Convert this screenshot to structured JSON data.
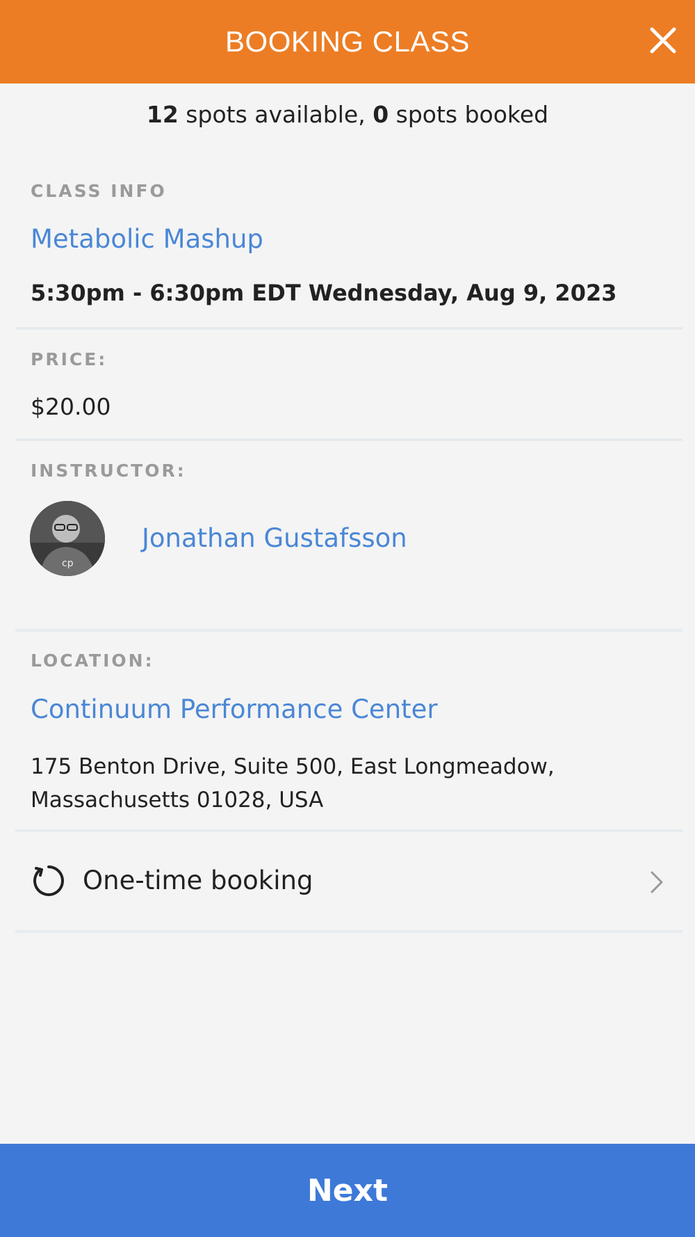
{
  "header": {
    "title": "BOOKING CLASS",
    "close_icon": "close-icon"
  },
  "availability": {
    "spots_available": "12",
    "available_text": " spots available, ",
    "spots_booked": "0",
    "booked_text": " spots booked"
  },
  "class_info": {
    "label": "CLASS INFO",
    "name": "Metabolic Mashup",
    "time": "5:30pm - 6:30pm EDT Wednesday, Aug 9, 2023"
  },
  "price": {
    "label": "PRICE:",
    "value": "$20.00"
  },
  "instructor": {
    "label": "INSTRUCTOR:",
    "name": "Jonathan Gustafsson",
    "avatar": "instructor-avatar"
  },
  "location": {
    "label": "LOCATION:",
    "name": "Continuum Performance Center",
    "address_line1": "175 Benton Drive, Suite 500, East Longmeadow,",
    "address_line2": "Massachusetts 01028, USA"
  },
  "booking_type": {
    "label": "One-time booking",
    "icon": "refresh-icon",
    "chevron": "chevron-right-icon"
  },
  "footer": {
    "next_label": "Next"
  },
  "colors": {
    "header": "#ec7d24",
    "link": "#4a87d6",
    "next": "#3e79d8",
    "background": "#f4f4f4"
  }
}
